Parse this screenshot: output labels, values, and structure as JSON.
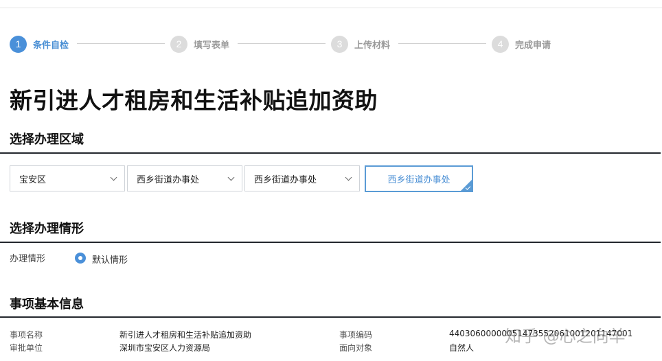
{
  "steps": [
    {
      "number": "1",
      "label": "条件自检"
    },
    {
      "number": "2",
      "label": "填写表单"
    },
    {
      "number": "3",
      "label": "上传材料"
    },
    {
      "number": "4",
      "label": "完成申请"
    }
  ],
  "page_title": "新引进人才租房和生活补贴追加资助",
  "region": {
    "section_title": "选择办理区域",
    "district": "宝安区",
    "street": "西乡街道办事处",
    "office": "西乡街道办事处",
    "selected_office": "西乡街道办事处"
  },
  "situation": {
    "section_title": "选择办理情形",
    "field_label": "办理情形",
    "option_label": "默认情形"
  },
  "info": {
    "section_title": "事项基本信息",
    "item_name_label": "事项名称",
    "item_name_value": "新引进人才租房和生活补贴追加资助",
    "item_code_label": "事项编码",
    "item_code_value": "44030600000051473552061001201147001",
    "approver_label": "审批单位",
    "approver_value": "深圳市宝安区人力资源局",
    "audience_label": "面向对象",
    "audience_value": "自然人"
  },
  "watermark": "知乎 @心之向羊",
  "colors": {
    "accent": "#4a90d9",
    "step_inactive": "#dcdcdc",
    "rule": "#23272d"
  }
}
